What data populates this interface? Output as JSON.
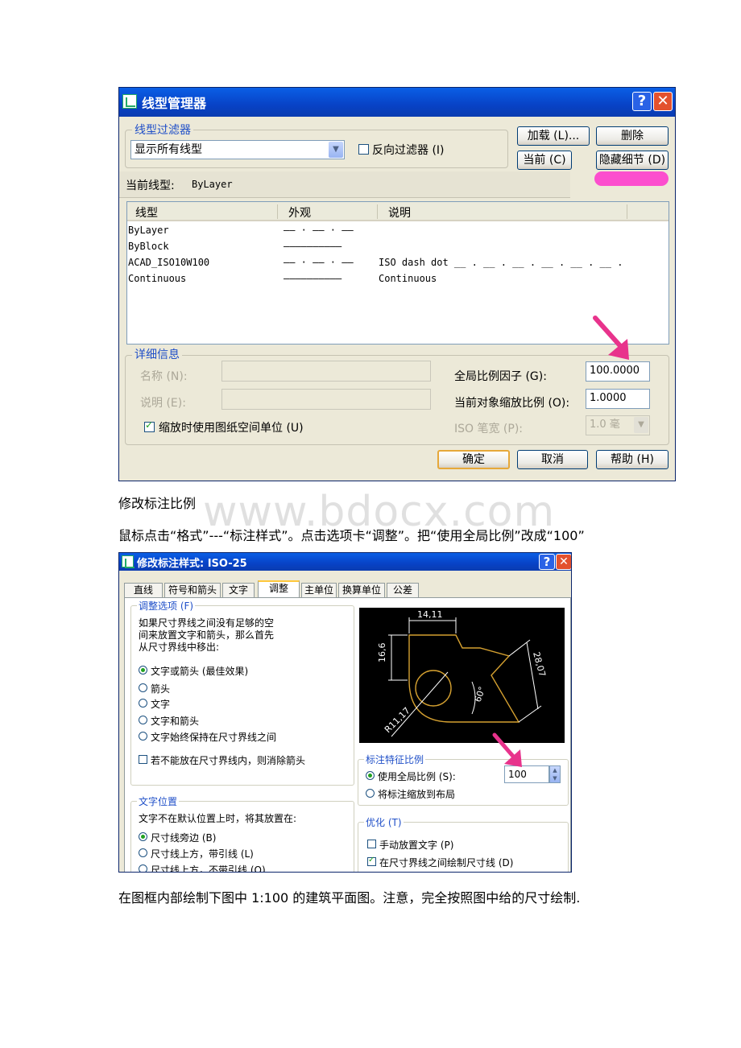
{
  "dialog1": {
    "title": "线型管理器",
    "help_btn": "?",
    "close_btn": "✕",
    "filter_group": "线型过滤器",
    "filter_value": "显示所有线型",
    "invert_filter": "反向过滤器 (I)",
    "load_btn": "加载 (L)...",
    "delete_btn": "删除",
    "current_btn": "当前 (C)",
    "hide_details_btn": "隐藏细节 (D)",
    "current_linetype_label": "当前线型:",
    "current_linetype_value": "ByLayer",
    "columns": [
      "线型",
      "外观",
      "说明"
    ],
    "rows": [
      {
        "name": "ByLayer",
        "appearance": "—— · —— · ——",
        "desc": ""
      },
      {
        "name": "ByBlock",
        "appearance": "——————————",
        "desc": ""
      },
      {
        "name": "ACAD_ISO10W100",
        "appearance": "—— · —— · ——",
        "desc": "ISO dash dot __ . __ . __ . __ . __ . __ ."
      },
      {
        "name": "Continuous",
        "appearance": "——————————",
        "desc": "Continuous"
      }
    ],
    "details_group": "详细信息",
    "name_label": "名称 (N):",
    "desc_label": "说明 (E):",
    "paper_space_checkbox": "缩放时使用图纸空间单位 (U)",
    "global_scale_label": "全局比例因子 (G):",
    "global_scale_value": "100.0000",
    "object_scale_label": "当前对象缩放比例 (O):",
    "object_scale_value": "1.0000",
    "iso_pen_label": "ISO 笔宽 (P):",
    "iso_pen_value": "1.0 毫",
    "ok_btn": "确定",
    "cancel_btn": "取消",
    "help_btn2": "帮助 (H)",
    "colors": {
      "highlight": "#FF33CC",
      "arrow": "#E8338C"
    }
  },
  "text": {
    "heading": "修改标注比例",
    "instruction": "鼠标点击“格式”---“标注样式”。点击选项卡“调整”。把“使用全局比例”改成“100”",
    "footer": "在图框内部绘制下图中 1:100 的建筑平面图。注意，完全按照图中给的尺寸绘制.",
    "watermark": "www.bdocx.com"
  },
  "dialog2": {
    "title": "修改标注样式: ISO-25",
    "tabs": [
      "直线",
      "符号和箭头",
      "文字",
      "调整",
      "主单位",
      "换算单位",
      "公差"
    ],
    "fit_group": "调整选项 (F)",
    "fit_desc": [
      "如果尺寸界线之间没有足够的空",
      "间来放置文字和箭头，那么首先",
      "从尺寸界线中移出:"
    ],
    "fit_options": [
      "文字或箭头 (最佳效果)",
      "箭头",
      "文字",
      "文字和箭头",
      "文字始终保持在尺寸界线之间"
    ],
    "suppress_arrows": "若不能放在尺寸界线内，则消除箭头",
    "text_pos_group": "文字位置",
    "text_pos_desc": "文字不在默认位置上时，将其放置在:",
    "text_pos_options": [
      "尺寸线旁边 (B)",
      "尺寸线上方，带引线 (L)",
      "尺寸线上方，不带引线 (O)"
    ],
    "scale_group": "标注特征比例",
    "use_global_scale": "使用全局比例 (S):",
    "global_scale_value": "100",
    "scale_to_layout": "将标注缩放到布局",
    "finetune_group": "优化 (T)",
    "manual_text": "手动放置文字 (P)",
    "draw_dim_line": "在尺寸界线之间绘制尺寸线 (D)",
    "preview_labels": {
      "top": "14,11",
      "left": "16,6",
      "diag": "28,07",
      "angle": "60°",
      "radius": "R11,17"
    }
  }
}
